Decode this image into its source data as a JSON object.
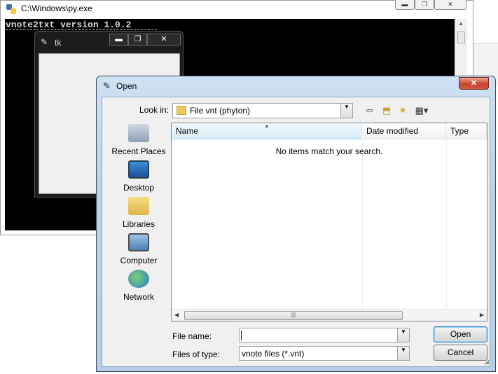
{
  "console_window": {
    "title": "C:\\Windows\\py.exe",
    "terminal_text": "vnote2txt version 1.0.2"
  },
  "tk_window": {
    "title": "tk",
    "minimize": "▬",
    "maximize": "❐",
    "close": "✕"
  },
  "open_dialog": {
    "title": "Open",
    "close": "✕",
    "look_in_label": "Look in:",
    "look_in_value": "File vnt (phyton)",
    "places": [
      {
        "label": "Recent Places",
        "icon": "recent-places-icon"
      },
      {
        "label": "Desktop",
        "icon": "desktop-icon"
      },
      {
        "label": "Libraries",
        "icon": "libraries-icon"
      },
      {
        "label": "Computer",
        "icon": "computer-icon"
      },
      {
        "label": "Network",
        "icon": "network-icon"
      }
    ],
    "columns": [
      "Name",
      "Date modified",
      "Type"
    ],
    "empty_message": "No items match your search.",
    "file_name_label": "File name:",
    "file_name_value": "",
    "files_of_type_label": "Files of type:",
    "files_of_type_value": "vnote files (*.vnt)",
    "open_button": "Open",
    "cancel_button": "Cancel"
  },
  "colors": {
    "dialog_frame": "#b9d1ea",
    "close_button": "#c7442e",
    "terminal_bg": "#000000"
  }
}
